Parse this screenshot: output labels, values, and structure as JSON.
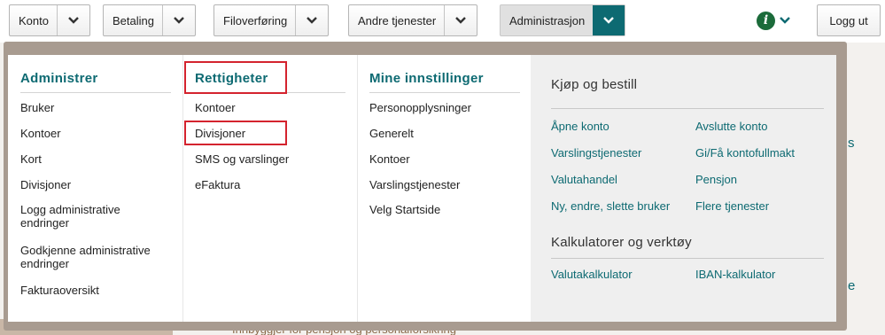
{
  "nav": {
    "konto": "Konto",
    "betaling": "Betaling",
    "filoverforing": "Filoverføring",
    "andre": "Andre tjenester",
    "admin": "Administrasjon",
    "logout": "Logg ut",
    "info_glyph": "i"
  },
  "background": {
    "bottom_text": "Innbyggjer for pensjon og personalforsikring",
    "letter_s": "s",
    "letter_e": "e"
  },
  "columns": {
    "administrer": {
      "heading": "Administrer",
      "items": [
        "Bruker",
        "Kontoer",
        "Kort",
        "Divisjoner",
        "Logg administrative endringer",
        "Godkjenne administrative endringer",
        "Fakturaoversikt"
      ]
    },
    "rettigheter": {
      "heading": "Rettigheter",
      "items": [
        "Kontoer",
        "Divisjoner",
        "SMS og varslinger",
        "eFaktura"
      ]
    },
    "innstillinger": {
      "heading": "Mine innstillinger",
      "items": [
        "Personopplysninger",
        "Generelt",
        "Kontoer",
        "Varslingstjenester",
        "Velg Startside"
      ]
    }
  },
  "kjop": {
    "heading": "Kjøp og bestill",
    "links": [
      "Åpne konto",
      "Avslutte konto",
      "Varslingstjenester",
      "Gi/Få kontofullmakt",
      "Valutahandel",
      "Pensjon",
      "Ny, endre, slette bruker",
      "Flere tjenester"
    ]
  },
  "kalk": {
    "heading": "Kalkulatorer og verktøy",
    "links": [
      "Valutakalkulator",
      "IBAN-kalkulator"
    ]
  },
  "colors": {
    "accent": "#0d6a72",
    "highlight": "#d4232e",
    "info_green": "#1b6b3a"
  }
}
